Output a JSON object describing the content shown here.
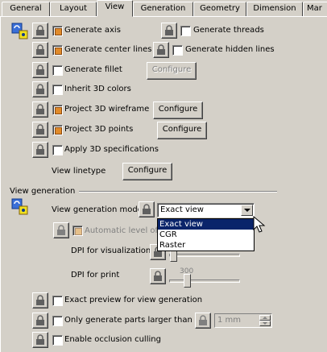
{
  "tabs": [
    {
      "label": "General"
    },
    {
      "label": "Layout"
    },
    {
      "label": "View",
      "active": true
    },
    {
      "label": "Generation"
    },
    {
      "label": "Geometry"
    },
    {
      "label": "Dimension"
    },
    {
      "label": "Mar"
    }
  ],
  "options": {
    "generate_axis": {
      "label": "Generate axis",
      "checked": true
    },
    "generate_threads": {
      "label": "Generate threads",
      "checked": false
    },
    "generate_center_lines": {
      "label": "Generate center lines",
      "checked": true
    },
    "generate_hidden_lines": {
      "label": "Generate hidden lines",
      "checked": false
    },
    "generate_fillet": {
      "label": "Generate fillet",
      "checked": false,
      "configure_label": "Configure"
    },
    "inherit_3d_colors": {
      "label": "Inherit 3D colors",
      "checked": false
    },
    "project_3d_wireframe": {
      "label": "Project 3D wireframe",
      "checked": true,
      "configure_label": "Configure"
    },
    "project_3d_points": {
      "label": "Project 3D points",
      "checked": true,
      "configure_label": "Configure"
    },
    "apply_3d_specifications": {
      "label": "Apply 3D specifications",
      "checked": false
    },
    "view_linetype": {
      "label": "View linetype",
      "configure_label": "Configure"
    }
  },
  "view_generation": {
    "section_title": "View generation",
    "mode_label": "View generation mode",
    "mode_value": "Exact view",
    "mode_options": [
      "Exact view",
      "CGR",
      "Raster"
    ],
    "selected_option": "Exact view",
    "automatic_level_label": "Automatic level of",
    "dpi_visualization_label": "DPI for visualization",
    "dpi_print_label": "DPI for print",
    "dpi_print_value": "300",
    "exact_preview_label": "Exact preview for view generation",
    "only_larger_label": "Only generate parts larger than",
    "only_larger_value": "1 mm",
    "occlusion_label": "Enable occlusion culling"
  },
  "colors": {
    "background": "#d4d0c8",
    "selection": "#0a246a",
    "checked_box": "#e08a2a"
  }
}
